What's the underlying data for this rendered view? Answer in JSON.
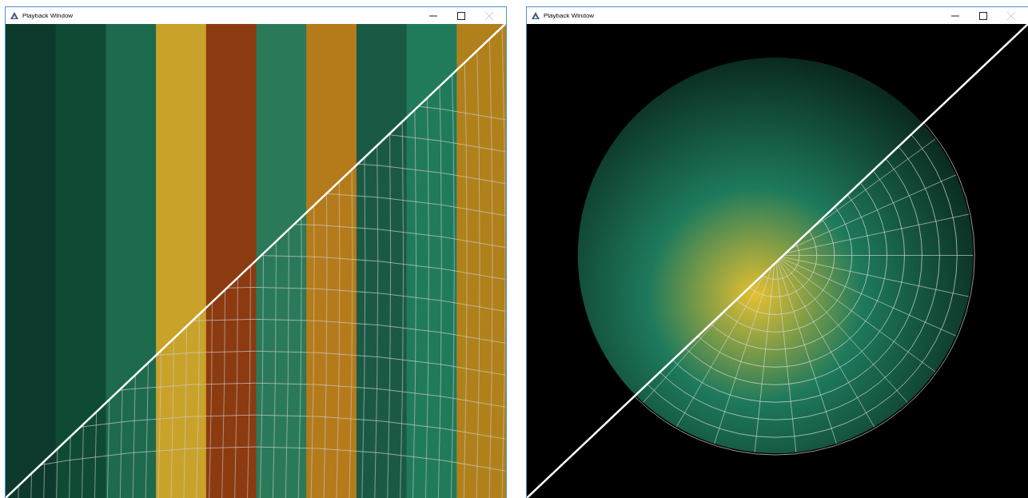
{
  "windows": [
    {
      "title": "Playback Window",
      "kind": "strips",
      "close_disabled": true
    },
    {
      "title": "Playback Window",
      "kind": "dome",
      "close_disabled": true
    }
  ]
}
